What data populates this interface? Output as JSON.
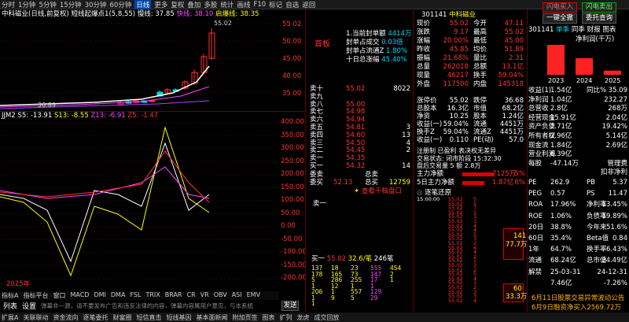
{
  "toolbar": [
    "分时",
    "1分钟",
    "5分钟",
    "15分钟",
    "30分钟",
    "60分钟",
    "日线",
    "更多",
    "复权",
    "叠加",
    "多股",
    "统计",
    "画线",
    "F10",
    "标记",
    "自选",
    "返回"
  ],
  "chart_header": {
    "name": "中科磁业(日线,前复权)",
    "indicator": "短线起爆点1(5,8,55)",
    "v1": "慢线: 37.85",
    "v2": "快线: 38.10",
    "v3": "启爆线: 38.35",
    "v4": ": 37.85",
    "v5": ": 38.10",
    "v6": ": 38.35"
  },
  "main_scale": [
    "55.02",
    "50.00",
    "45.00",
    "40.00",
    "35.00"
  ],
  "price_labels": {
    "high": "55.02",
    "low": "36.89"
  },
  "sub_header": {
    "name": "JJM2",
    "s5": "S5: -13.91",
    "s13": "S13: -8.55",
    "z13": "Z13: -6.91",
    "z5": "Z5: -1.47"
  },
  "sub_scale": [
    "400.00",
    "350.00",
    "300.00",
    "250.00",
    "200.00",
    "150.00",
    "100.00",
    "50.00",
    "0.00",
    "-50.00",
    "-100.00",
    "-150.00",
    "-200.00"
  ],
  "year_label": "2025年",
  "tabs": [
    "指标A",
    "指标平台",
    "窗口",
    "MACD",
    "DMI",
    "DMA",
    "FSL",
    "TRIX",
    "BRAR",
    "CR",
    "VR",
    "OBV",
    "ASI",
    "EMV"
  ],
  "settings": [
    "列表",
    "设置"
  ],
  "notice": "弹幕非一源，请不要发布广告和违反法律的内容，弹幕内容属用户意见，与本系统",
  "send": "发送",
  "bottom_tabs": [
    "扩展A",
    "关联联动",
    "资金流向",
    "逐笔委托",
    "财富圈",
    "短信直击",
    "短线基因",
    "基本面新闻",
    "附加页签",
    "图表",
    "扩列",
    "龙虎",
    "成交回放"
  ],
  "limit_up": {
    "title": "首板",
    "items": [
      {
        "k": "1.当前封单额",
        "v": "4414万"
      },
      {
        "k": "封单占成交",
        "v": "0.03倍"
      },
      {
        "k": "封单占流通Z",
        "v": "1.80%"
      },
      {
        "k": "十日总涨幅",
        "v": "45.40%"
      }
    ]
  },
  "stock": {
    "code": "301141",
    "name": "中科磁业"
  },
  "quote": [
    {
      "a": "现价",
      "b": "55.02",
      "c": "今开",
      "d": "47.11"
    },
    {
      "a": "涨跌",
      "b": "9.17",
      "c": "最高",
      "d": "55.02"
    },
    {
      "a": "涨幅",
      "b": "20.00%",
      "c": "最低",
      "d": "45.00"
    },
    {
      "a": "昨收",
      "b": "45.85",
      "c": "均价",
      "d": "51.89"
    },
    {
      "a": "振幅",
      "b": "21.68%",
      "c": "量比",
      "d": "2.31"
    },
    {
      "a": "总量",
      "b": "262018",
      "c": "总额",
      "d": "13.1亿"
    },
    {
      "a": "现量",
      "b": "46217",
      "c": "换手",
      "d": "59.04%"
    },
    {
      "a": "外盘",
      "b": "117500",
      "c": "内盘",
      "d": "145318"
    }
  ],
  "sell": [
    {
      "n": "卖十",
      "p": "55.02",
      "v": "8022"
    },
    {
      "n": "卖九",
      "p": "",
      "v": ""
    },
    {
      "n": "卖八",
      "p": "55.00",
      "v": ""
    },
    {
      "n": "卖七",
      "p": "54.98",
      "v": ""
    },
    {
      "n": "卖六",
      "p": "54.94",
      "v": ""
    },
    {
      "n": "卖五",
      "p": "54.81",
      "v": "3"
    },
    {
      "n": "卖四",
      "p": "54.60",
      "v": "13"
    },
    {
      "n": "卖三",
      "p": "54.50",
      "v": "4"
    },
    {
      "n": "卖二",
      "p": "54.45",
      "v": "2"
    },
    {
      "n": "卖一",
      "p": "54.35",
      "v": ""
    },
    {
      "n": "买一",
      "p": "54.32",
      "v": "14"
    }
  ],
  "bid_summary": [
    {
      "a": "委卖",
      "b": "",
      "c": "总卖",
      "d": ""
    },
    {
      "a": "委买",
      "b": "52.13",
      "c": "总买",
      "d": "12759"
    }
  ],
  "orderbook_link": "查看千档盘口",
  "fund": [
    {
      "a": "涨停价",
      "b": "55.02",
      "c": "跌停",
      "d": "36.68"
    },
    {
      "a": "总股本",
      "b": "16.3亿",
      "c": "市值",
      "d": "68.2亿"
    },
    {
      "a": "净资",
      "b": "10.25",
      "c": "股本",
      "d": "1.24亿"
    },
    {
      "a": "收益(一)",
      "b": "59.04%",
      "c": "流通",
      "d": "4451万"
    },
    {
      "a": "换手Z",
      "b": "59.04%",
      "c": "流通Z",
      "d": "4451万"
    },
    {
      "a": "收益(一)",
      "b": "0.110",
      "c": "PE(动)",
      "d": "57.0"
    }
  ],
  "info_lines": [
    "注册制 已盈利 表决权无差异",
    "交易状态: 闭市阶段 15:32:30",
    "盘后交易量 5 额 2.8万"
  ],
  "main_force": [
    {
      "k": "主力净额",
      "v": "7125万",
      "p": "5%"
    },
    {
      "k": "5日主力净额",
      "v": "1.87亿",
      "p": "6%"
    }
  ],
  "trades_header": "逐笔还原",
  "trades": [
    {
      "t": "15:00:00",
      "p": "55.02",
      "v": "5"
    },
    {
      "t": "",
      "p": "55.02",
      "v": "5"
    },
    {
      "t": "",
      "p": "55.02",
      "v": "7"
    },
    {
      "t": "",
      "p": "55.02",
      "v": "5"
    },
    {
      "t": "",
      "p": "55.02",
      "v": "3"
    },
    {
      "t": "",
      "p": "55.02",
      "v": "1"
    },
    {
      "t": "",
      "p": "55.02",
      "v": "4"
    },
    {
      "t": "",
      "p": "55.02",
      "v": "4"
    },
    {
      "t": "",
      "p": "55.02",
      "v": "5"
    },
    {
      "t": "",
      "p": "55.02",
      "v": "3"
    },
    {
      "t": "",
      "p": "55.02",
      "v": "2"
    },
    {
      "t": "",
      "p": "55.02",
      "v": "6"
    },
    {
      "t": "",
      "p": "55.02",
      "v": "4"
    },
    {
      "t": "",
      "p": "55.02",
      "v": "2"
    },
    {
      "t": "",
      "p": "55.02",
      "v": "1"
    },
    {
      "t": "",
      "p": "55.02",
      "v": "3"
    },
    {
      "t": "",
      "p": "55.02",
      "v": "2"
    },
    {
      "t": "",
      "p": "55.02",
      "v": "5"
    },
    {
      "t": "",
      "p": "55.02",
      "v": "4"
    },
    {
      "t": "",
      "p": "55.02",
      "v": "1"
    },
    {
      "t": "",
      "p": "55.02",
      "v": "2"
    },
    {
      "t": "",
      "p": "55.02",
      "v": "3"
    },
    {
      "t": "",
      "p": "55.02",
      "v": "3"
    },
    {
      "t": "",
      "p": "55.02",
      "v": "4"
    }
  ],
  "trade_bars": [
    {
      "v": "141",
      "v2": "77.7万"
    },
    {
      "v": "60",
      "v2": "33.3万"
    }
  ],
  "buy_header": {
    "k": "买一",
    "p": "55.02",
    "s": "32.6/笔",
    "n": "246笔"
  },
  "buy_rows": [
    [
      "137",
      "18",
      "23",
      "555",
      "454"
    ],
    [
      "178",
      "165",
      "73",
      "147",
      "2"
    ],
    [
      "5",
      "286",
      "255",
      "17",
      "1"
    ],
    [
      "1",
      "12",
      "1",
      "1",
      ""
    ],
    [
      "206",
      "1",
      "557",
      "129",
      ""
    ],
    [
      "1",
      "9",
      "5",
      "29",
      ""
    ],
    [
      "1",
      "",
      "",
      "",
      ""
    ]
  ],
  "right_buttons": [
    "闪电买入",
    "闪电卖出",
    "一键全撤",
    "委托查询"
  ],
  "profit": {
    "code": "301141",
    "tabs": [
      "单季",
      "同季",
      "财报",
      "图表"
    ],
    "title": "净利润(千万)",
    "years": [
      "2023",
      "2024",
      "2025"
    ],
    "values": [
      3.6,
      2.0,
      0.5
    ]
  },
  "fin": [
    {
      "a": "收益(1)",
      "b": "1.54亿",
      "c": "同比%",
      "d": "35.09"
    },
    {
      "a": "净利润",
      "b": "1.04亿",
      "c": "",
      "d": "232.27"
    },
    {
      "a": "总营收",
      "b": "2.8亿",
      "c": "",
      "d": "268万"
    },
    {
      "a": "经营现金",
      "b": "15.91亿",
      "c": "",
      "d": "2.04亿"
    },
    {
      "a": "资产负债",
      "b": "2.71亿",
      "c": "",
      "d": "19.42%"
    },
    {
      "a": "所有者权",
      "b": "2.96亿",
      "c": "",
      "d": "5.14亿"
    },
    {
      "a": "现金流",
      "b": "1.84亿",
      "c": "",
      "d": "2.69亿"
    },
    {
      "a": "营业利润",
      "b": "6.39亿",
      "c": "",
      "d": ""
    },
    {
      "a": "每股",
      "b": "-47.14万",
      "c": "",
      "d": "管理费"
    },
    {
      "a": "",
      "b": "",
      "c": "",
      "d": "扣非净利"
    }
  ],
  "val": [
    {
      "a": "PE",
      "b": "262.9",
      "c": "PB",
      "d": "5.37"
    },
    {
      "a": "PEG",
      "b": "0.57",
      "c": "PS",
      "d": "11.47"
    },
    {
      "a": "ROA",
      "b": "17.96%",
      "c": "净利率",
      "d": "13.45%"
    },
    {
      "a": "ROE",
      "b": "1.06%",
      "c": "负债率",
      "d": "19.89%"
    },
    {
      "a": "20日",
      "b": "38.8%",
      "c": "今年来",
      "d": "51.6%"
    },
    {
      "a": "60日",
      "b": "35.4%",
      "c": "Beta值",
      "d": "0.84"
    },
    {
      "a": "1年",
      "b": "64.7%",
      "c": "换手率",
      "d": "6.43%"
    },
    {
      "a": "流通",
      "b": "68.24亿",
      "c": "总市值",
      "d": "24.49亿"
    },
    {
      "a": "解禁",
      "b": "25-03-31",
      "c": "",
      "d": "24-12-31"
    },
    {
      "a": "",
      "b": "7.46亿",
      "c": "",
      "d": "-7.26%"
    }
  ],
  "right_notice": [
    "6月11日股票交易异常波动公告",
    "6月9日融资净买入2569.72万"
  ]
}
